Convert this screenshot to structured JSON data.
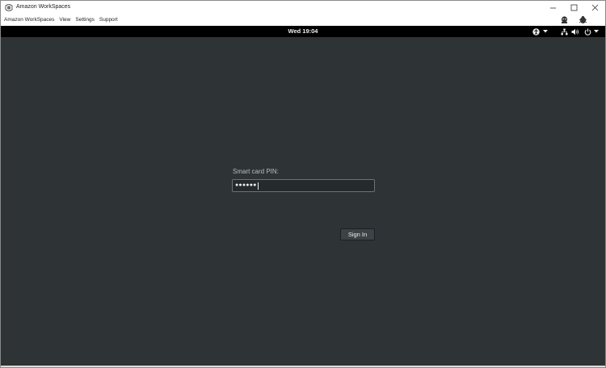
{
  "window": {
    "title": "Amazon WorkSpaces",
    "controls": [
      "minimize-icon",
      "maximize-icon",
      "close-icon"
    ]
  },
  "menu": {
    "items": [
      "Amazon WorkSpaces",
      "View",
      "Settings",
      "Support"
    ],
    "icons": [
      "network-health-icon",
      "bug-report-icon"
    ]
  },
  "desktop": {
    "clock": "Wed 19:04",
    "tray_icons": [
      "accessibility-icon",
      "dropdown-icon",
      "network-icon",
      "volume-icon",
      "power-icon",
      "dropdown-icon"
    ],
    "background": "#2e3436"
  },
  "login": {
    "prompt_label": "Smart card PIN:",
    "pin_masked": "●●●●●●",
    "signin_label": "Sign In"
  }
}
